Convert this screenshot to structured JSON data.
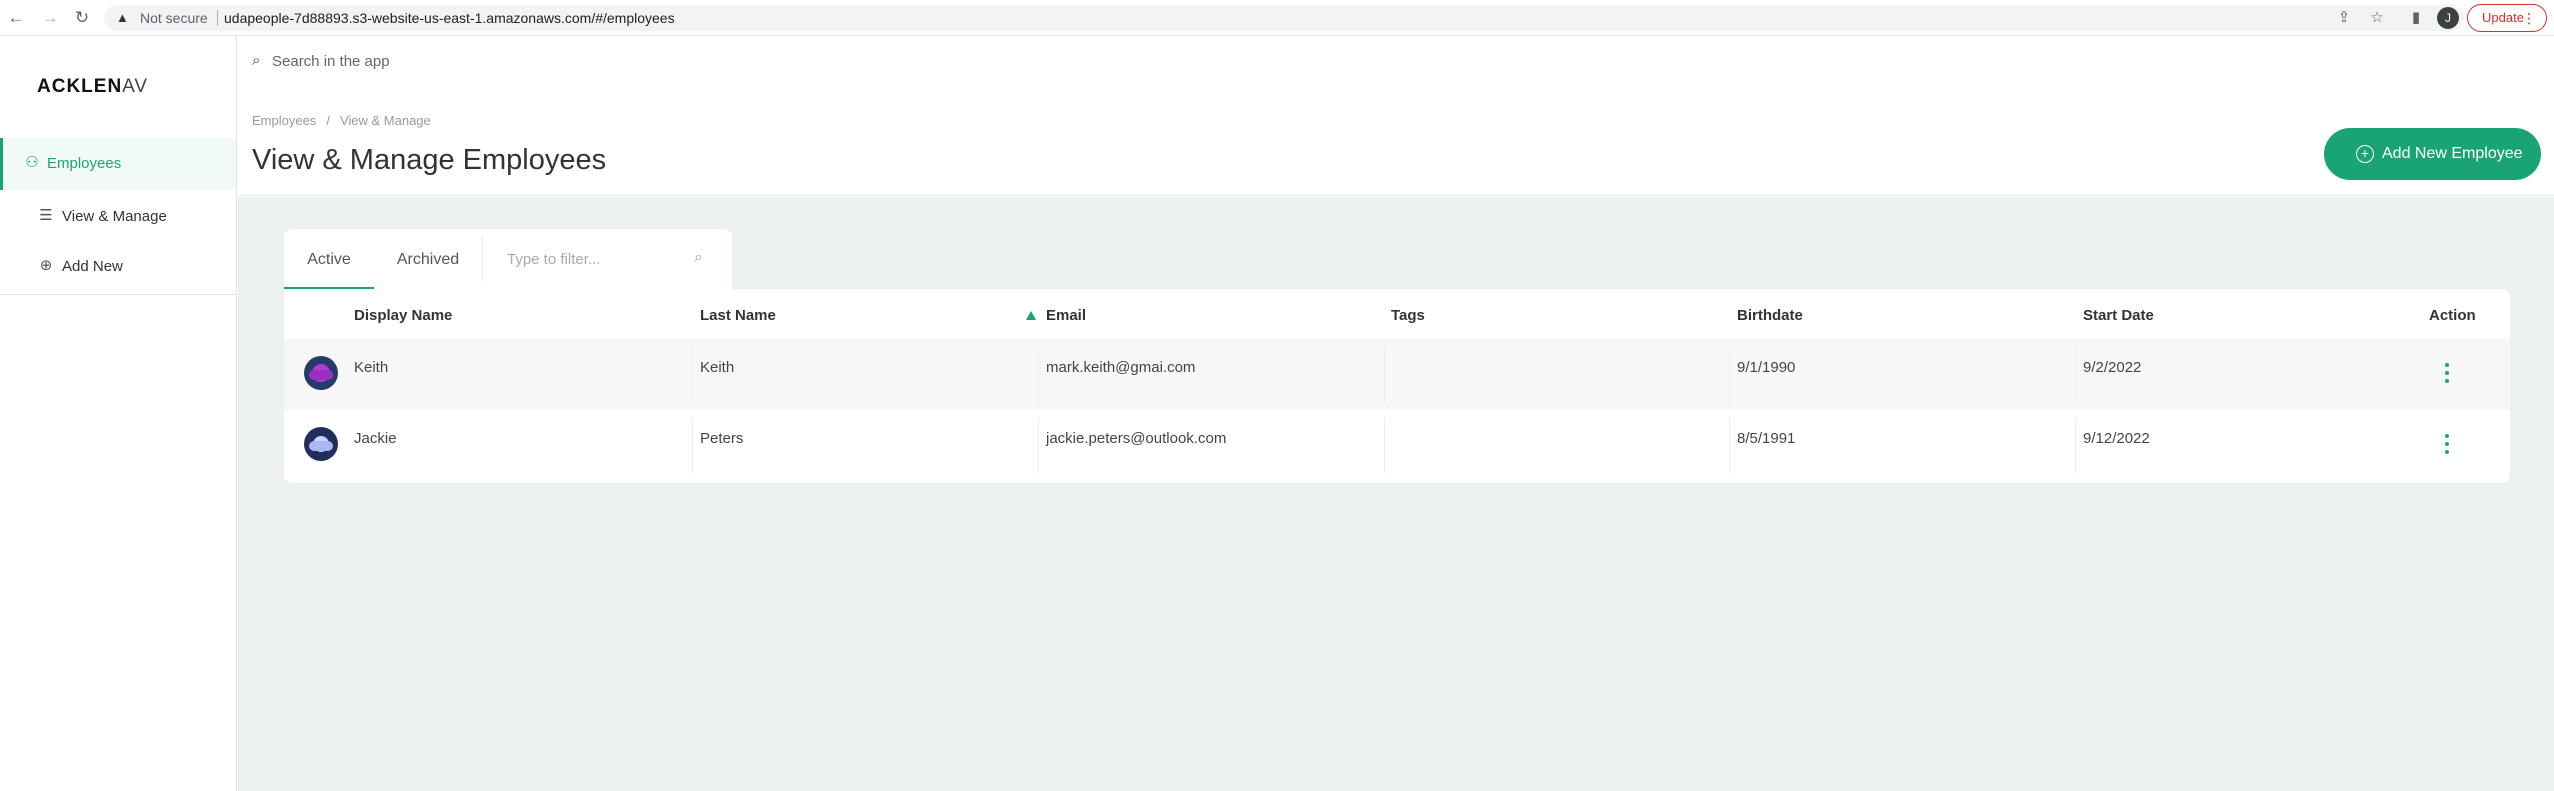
{
  "browser": {
    "security_label": "Not secure",
    "url": "udapeople-7d88893.s3-website-us-east-1.amazonaws.com/#/employees",
    "profile_initial": "J",
    "update_label": "Update"
  },
  "sidebar": {
    "logo_main": "ACKLEN",
    "logo_tail": "AV",
    "items": [
      {
        "label": "Employees",
        "icon": "person-icon"
      },
      {
        "label": "View & Manage",
        "icon": "list-icon"
      },
      {
        "label": "Add New",
        "icon": "plus-circle-icon"
      }
    ]
  },
  "search": {
    "placeholder": "Search in the app"
  },
  "header": {
    "breadcrumb": [
      "Employees",
      "View & Manage"
    ],
    "title": "View & Manage Employees",
    "add_button_label": "Add New Employee"
  },
  "tabs": [
    {
      "label": "Active"
    },
    {
      "label": "Archived"
    }
  ],
  "filter": {
    "placeholder": "Type to filter..."
  },
  "table": {
    "columns": [
      "Display Name",
      "Last Name",
      "Email",
      "Tags",
      "Birthdate",
      "Start Date",
      "Action"
    ],
    "rows": [
      {
        "display_name": "Keith",
        "last_name": "Keith",
        "email": "mark.keith@gmai.com",
        "tags": "",
        "birthdate": "9/1/1990",
        "start_date": "9/2/2022"
      },
      {
        "display_name": "Jackie",
        "last_name": "Peters",
        "email": "jackie.peters@outlook.com",
        "tags": "",
        "birthdate": "8/5/1991",
        "start_date": "9/12/2022"
      }
    ]
  },
  "colors": {
    "accent": "#1aa474",
    "update": "#d93025",
    "content_bg": "#edf0f0"
  }
}
